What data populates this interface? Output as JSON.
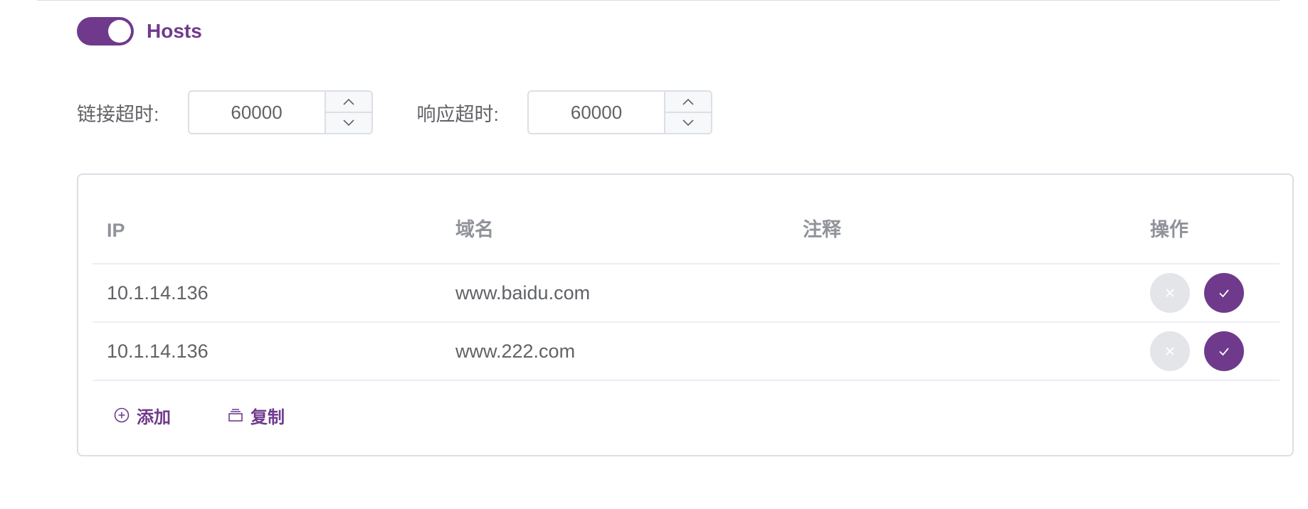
{
  "hosts_switch": {
    "label": "Hosts",
    "on": true
  },
  "timeouts": {
    "connect": {
      "label": "链接超时:",
      "value": "60000"
    },
    "response": {
      "label": "响应超时:",
      "value": "60000"
    }
  },
  "table": {
    "headers": {
      "ip": "IP",
      "domain": "域名",
      "note": "注释",
      "op": "操作"
    },
    "rows": [
      {
        "ip": "10.1.14.136",
        "domain": "www.baidu.com",
        "note": ""
      },
      {
        "ip": "10.1.14.136",
        "domain": "www.222.com",
        "note": ""
      }
    ]
  },
  "actions": {
    "add": "添加",
    "copy": "复制"
  },
  "colors": {
    "accent": "#6f3a8c",
    "cancel_bg": "#e4e5e9",
    "border": "#dcdfe6"
  },
  "icons": {
    "row_cancel": "close-icon",
    "row_confirm": "check-icon",
    "add": "plus-circle-icon",
    "copy": "copy-icon",
    "stepper_up": "chevron-up-icon",
    "stepper_down": "chevron-down-icon"
  }
}
